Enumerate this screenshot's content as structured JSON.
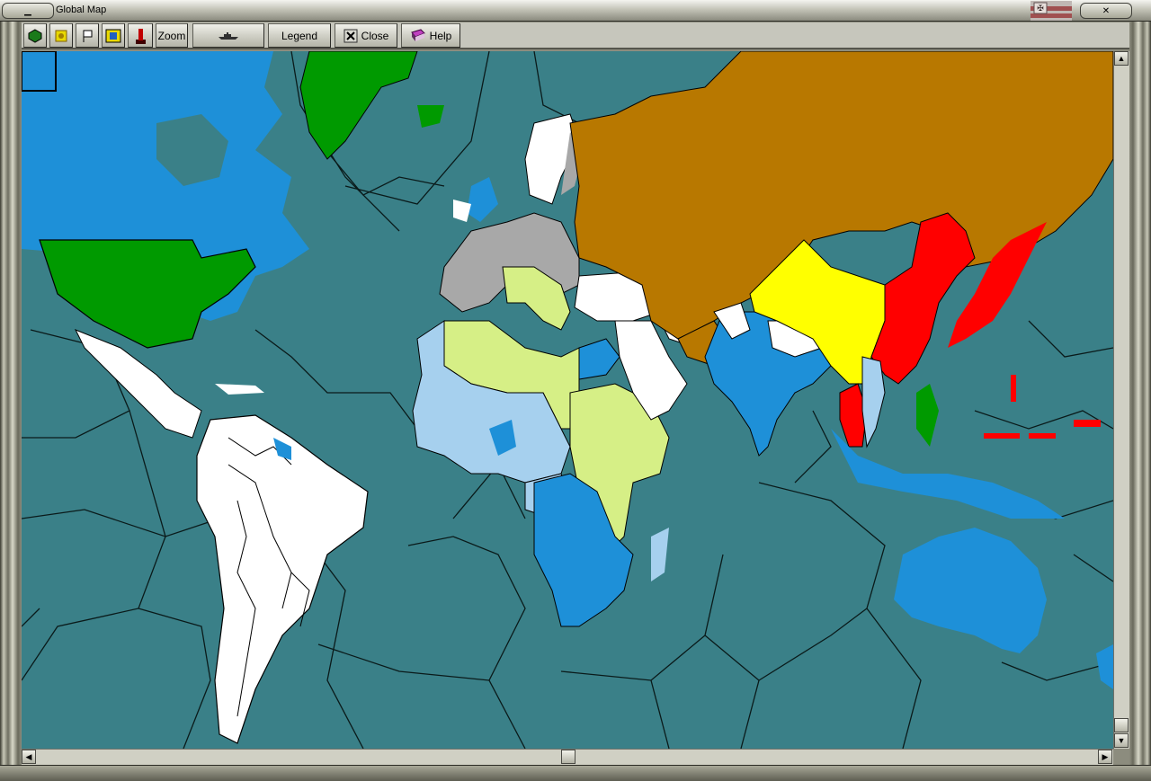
{
  "window": {
    "title": "Global Map"
  },
  "toolbar": {
    "zoom_label": "Zoom",
    "legend_label": "Legend",
    "close_label": "Close",
    "help_label": "Help"
  },
  "icons": {
    "close": "close-icon",
    "help": "help-book-icon",
    "minimize": "minimize-icon",
    "maximize": "maximize-icon",
    "units": "unit-hex-icon",
    "resources": "resource-icon",
    "flag": "flag-icon",
    "province": "province-icon",
    "industry": "industry-icon",
    "ships": "ship-icon",
    "nation_flag": "nation-flag-icon"
  },
  "colors": {
    "ocean": "#3a8088",
    "uk_empire": "#1e90d8",
    "france_sphere": "#a6d0ee",
    "italy_sphere": "#d6ef86",
    "germany_sphere": "#a8a8a8",
    "ussr": "#b87800",
    "usa": "#009a00",
    "japan": "#ff0000",
    "china": "#ffff00",
    "neutral": "#ffffff"
  }
}
